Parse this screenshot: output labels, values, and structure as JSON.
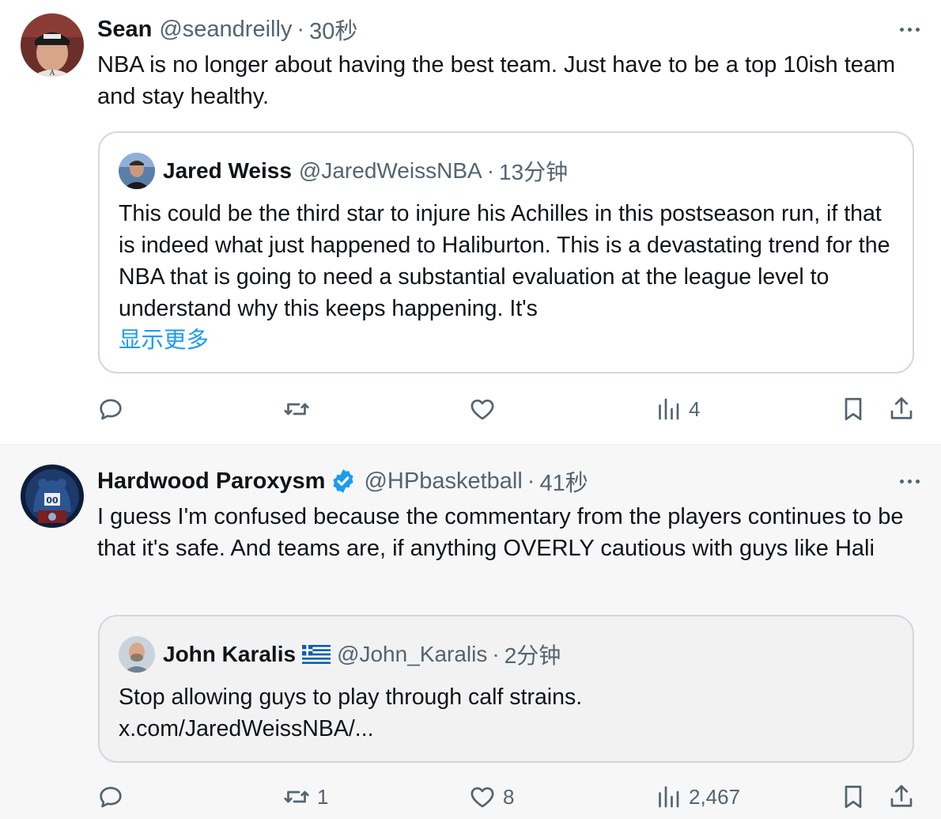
{
  "tweets": [
    {
      "author_name": "Sean",
      "author_handle": "@seandreilly",
      "separator": "·",
      "time": "30秒",
      "text": "NBA is no longer about having the best team. Just have to be a top 10ish team and stay healthy.",
      "quote": {
        "author_name": "Jared Weiss",
        "author_handle": "@JaredWeissNBA",
        "separator": "·",
        "time": "13分钟",
        "text": "This could be the third star to injure his Achilles in this postseason run, if that is indeed what just happened to Haliburton. This is a devastating trend for the NBA that is going to need a substantial evaluation at the league level to understand why this keeps happening. It's",
        "show_more": "显示更多"
      },
      "actions": {
        "reply_icon": "reply-icon",
        "retweet_icon": "retweet-icon",
        "like_icon": "heart-icon",
        "views_icon": "views-icon",
        "views": "4",
        "bookmark_icon": "bookmark-icon",
        "share_icon": "share-icon"
      }
    },
    {
      "author_name": "Hardwood Paroxysm",
      "author_handle": "@HPbasketball",
      "separator": "·",
      "time": "41秒",
      "verified": true,
      "text": "I guess I'm confused because the commentary from the players continues to be that it's safe. And teams are, if anything OVERLY cautious with guys like Hali",
      "quote": {
        "author_name": "John Karalis",
        "author_handle": "@John_Karalis",
        "separator": "·",
        "time": "2分钟",
        "flag": "greek-flag-icon",
        "text": "Stop allowing guys to play through calf strains.",
        "link": "x.com/JaredWeissNBA/..."
      },
      "actions": {
        "reply_icon": "reply-icon",
        "retweet_icon": "retweet-icon",
        "retweets": "1",
        "like_icon": "heart-icon",
        "likes": "8",
        "views_icon": "views-icon",
        "views": "2,467",
        "bookmark_icon": "bookmark-icon",
        "share_icon": "share-icon"
      }
    }
  ],
  "colors": {
    "accent": "#1d9bf0",
    "secondary_text": "#536471",
    "border": "#cfd9de"
  }
}
